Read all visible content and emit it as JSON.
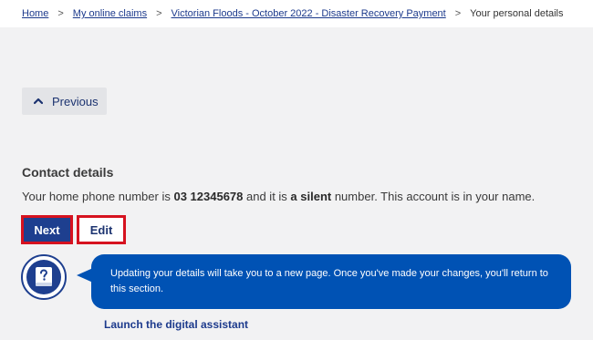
{
  "breadcrumb": {
    "items": [
      "Home",
      "My online claims",
      "Victorian Floods - October 2022 - Disaster Recovery Payment"
    ],
    "separator": ">",
    "current": "Your personal details"
  },
  "previous_button": {
    "label": "Previous",
    "icon": "chevron-up-icon"
  },
  "contact": {
    "title": "Contact details",
    "text_prefix": "Your home phone number is ",
    "phone": "03 12345678",
    "text_middle": " and it is ",
    "number_type": "a silent",
    "text_suffix": " number. This account is in your name."
  },
  "actions": {
    "next_label": "Next",
    "edit_label": "Edit"
  },
  "assistant": {
    "icon": "question-book-icon",
    "message": "Updating your details will take you to a new page. Once you've made your changes, you'll return to this section.",
    "launch_label": "Launch the digital assistant"
  },
  "colors": {
    "primary": "#1e3f8f",
    "bubble": "#0052b4",
    "highlight": "#d6121f",
    "background": "#f2f2f3"
  }
}
